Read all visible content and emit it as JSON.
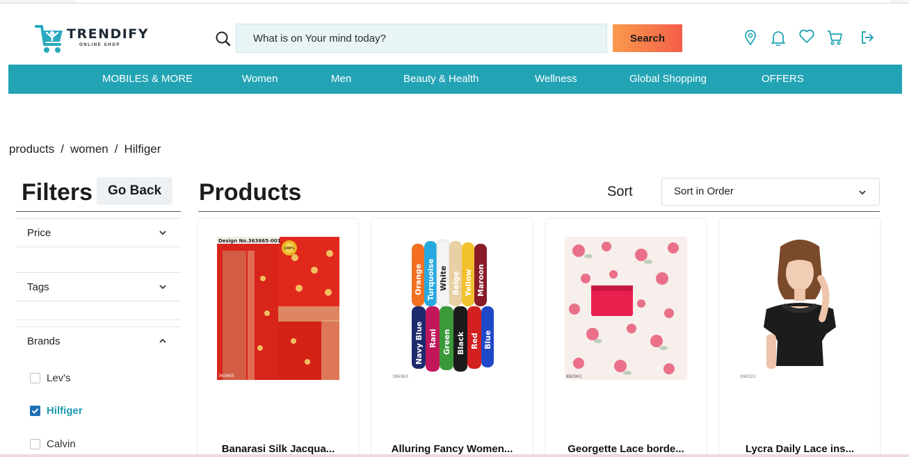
{
  "brand": {
    "name": "TRENDIFY",
    "tagline": "ONLINE SHOP",
    "color": "#22a4b5"
  },
  "search": {
    "placeholder": "What is on Your mind today?",
    "button_label": "Search",
    "icon": "search-icon"
  },
  "header_icons": [
    "location-icon",
    "bell-icon",
    "heart-icon",
    "cart-icon",
    "login-icon"
  ],
  "nav": {
    "items": [
      "MOBILES & MORE",
      "Women",
      "Men",
      "Beauty & Health",
      "Wellness",
      "Global Shopping",
      "OFFERS"
    ]
  },
  "breadcrumb": [
    "products",
    "/",
    "women",
    "/",
    "Hilfiger"
  ],
  "filters": {
    "title": "Filters",
    "go_back": "Go Back",
    "sections": [
      {
        "label": "Price",
        "expanded": false
      },
      {
        "label": "Tags",
        "expanded": false
      },
      {
        "label": "Brands",
        "expanded": true
      }
    ],
    "brands": [
      {
        "label": "Lev's",
        "checked": false
      },
      {
        "label": "Hilfiger",
        "checked": true
      },
      {
        "label": "Calvin",
        "checked": false
      }
    ]
  },
  "products": {
    "title": "Products",
    "sort_label": "Sort",
    "sort_value": "Sort in Order",
    "items": [
      {
        "name": "Banarasi Silk Jacqua...",
        "image_caption": "Design No.363665-001",
        "badge": "100%",
        "code": "363665"
      },
      {
        "name": "Alluring Fancy Women...",
        "colors": [
          "Orange",
          "Turquoise",
          "White",
          "Beige",
          "Yellow",
          "Maroon",
          "Navy Blue",
          "Rani",
          "Green",
          "Black",
          "Red",
          "Blue"
        ],
        "code": "386963"
      },
      {
        "name": "Georgette Lace borde...",
        "code": "882961"
      },
      {
        "name": "Lycra Daily Lace ins...",
        "code": "090321"
      }
    ]
  },
  "colors": {
    "accent": "#22a4b5",
    "search_grad_start": "#f99a4c",
    "search_grad_end": "#f55e4a",
    "checkbox": "#1f6fb8",
    "active_brand": "#1b9bb0"
  }
}
